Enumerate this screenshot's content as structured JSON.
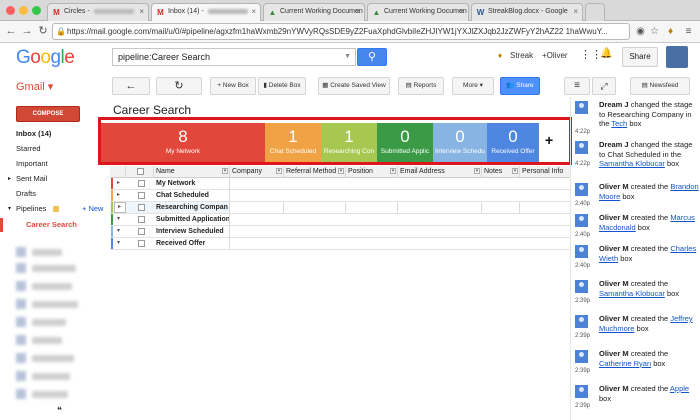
{
  "browser": {
    "tabs": [
      {
        "title": "Circles -",
        "icon": "M",
        "icon_color": "#d93025",
        "active": false
      },
      {
        "title": "Inbox (14) -",
        "icon": "M",
        "icon_color": "#d93025",
        "active": true
      },
      {
        "title": "Current Working Documen",
        "icon": "▲",
        "icon_color": "#3b8e3b",
        "active": false
      },
      {
        "title": "Current Working Documen",
        "icon": "▲",
        "icon_color": "#3b8e3b",
        "active": false
      },
      {
        "title": "StreakBlog.docx - Google",
        "icon": "W",
        "icon_color": "#2b579a",
        "active": false
      }
    ],
    "url": "https://mail.google.com/mail/u/0/#pipeline/agxzfm1haWxmb29nYWVyRQsSDE9yZ2FuaXphdGlvbiIeZHJIYW1jYXJlZXJqb2JzZWFyY2hAZ22 1haWwuY..."
  },
  "header": {
    "logo": "Google",
    "search_value": "pipeline:Career Search",
    "streak": "Streak",
    "user": "+Oliver",
    "share": "Share"
  },
  "toolbar": {
    "gmail": "Gmail",
    "new_box": "New Box",
    "delete_box": "Delete Box",
    "create_saved_view": "Create Saved View",
    "reports": "Reports",
    "more": "More",
    "share": "Share",
    "newsfeed": "Newsfeed"
  },
  "sidebar": {
    "compose": "COMPOSE",
    "items": [
      "Inbox (14)",
      "Starred",
      "Important",
      "Sent Mail",
      "Drafts",
      "Pipelines"
    ],
    "new_link": "+ New",
    "active_pipeline": "Career Search"
  },
  "pipeline": {
    "title": "Career Search",
    "stages": [
      {
        "count": "8",
        "label": "My Network",
        "color": "#e2473b"
      },
      {
        "count": "1",
        "label": "Chat Scheduled",
        "color": "#f0a244"
      },
      {
        "count": "1",
        "label": "Researching Con",
        "color": "#a6c851"
      },
      {
        "count": "0",
        "label": "Submitted Applic",
        "color": "#3b9a46"
      },
      {
        "count": "0",
        "label": "Interview Schedu",
        "color": "#88b4e3"
      },
      {
        "count": "0",
        "label": "Received Offer",
        "color": "#4f86e0"
      }
    ],
    "add": "+"
  },
  "grid": {
    "columns": [
      "Name",
      "Company",
      "Referral Method",
      "Position",
      "Email Address",
      "Notes",
      "Personal Info"
    ],
    "rows": [
      {
        "name": "My Network",
        "color": "#e2473b"
      },
      {
        "name": "Chat Scheduled",
        "color": "#f0a244"
      },
      {
        "name": "Researching Compan",
        "color": "#a6c851"
      },
      {
        "name": "Submitted Application",
        "color": "#3b9a46"
      },
      {
        "name": "Interview Scheduled",
        "color": "#88b4e3"
      },
      {
        "name": "Received Offer",
        "color": "#4f86e0"
      }
    ]
  },
  "feed": [
    {
      "time": "4:22p",
      "name": "Dream J",
      "pre": "changed the stage to Researching Company in the",
      "link": "Tech",
      "post": "box"
    },
    {
      "time": "4:22p",
      "name": "Dream J",
      "pre": "changed the stage to Chat Scheduled in the",
      "link": "Samantha Klobucar",
      "post": "box"
    },
    {
      "time": "2:40p",
      "name": "Oliver M",
      "pre": "created the",
      "link": "Brandon Moore",
      "post": "box"
    },
    {
      "time": "2:40p",
      "name": "Oliver M",
      "pre": "created the",
      "link": "Marcus Macdonald",
      "post": "box"
    },
    {
      "time": "2:40p",
      "name": "Oliver M",
      "pre": "created the",
      "link": "Charles Wieth",
      "post": "box"
    },
    {
      "time": "2:39p",
      "name": "Oliver M",
      "pre": "created the",
      "link": "Samantha Klobucar",
      "post": "box"
    },
    {
      "time": "2:39p",
      "name": "Oliver M",
      "pre": "created the",
      "link": "Jeffrey Muchmore",
      "post": "box"
    },
    {
      "time": "2:39p",
      "name": "Oliver M",
      "pre": "created the",
      "link": "Catherine Ryan",
      "post": "box"
    },
    {
      "time": "2:39p",
      "name": "Oliver M",
      "pre": "created the",
      "link": "Apple",
      "post": "box"
    }
  ]
}
